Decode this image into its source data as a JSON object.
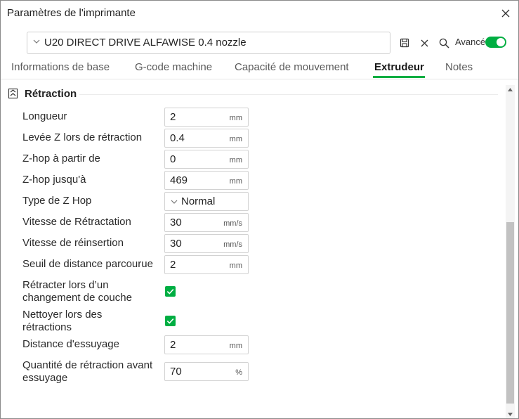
{
  "window": {
    "title": "Paramètres de l'imprimante"
  },
  "preset": {
    "name": "U20 DIRECT DRIVE ALFAWISE 0.4 nozzle",
    "advanced_label": "Avancé",
    "advanced_on": true
  },
  "tabs": [
    {
      "label": "Informations de base"
    },
    {
      "label": "G-code machine"
    },
    {
      "label": "Capacité de mouvement"
    },
    {
      "label": "Extrudeur",
      "active": true
    },
    {
      "label": "Notes"
    }
  ],
  "section": {
    "title": "Rétraction"
  },
  "settings": [
    {
      "label": "Longueur",
      "value": "2",
      "unit": "mm"
    },
    {
      "label": "Levée Z lors de rétraction",
      "value": "0.4",
      "unit": "mm"
    },
    {
      "label": "Z-hop à partir de",
      "value": "0",
      "unit": "mm"
    },
    {
      "label": "Z-hop jusqu'à",
      "value": "469",
      "unit": "mm"
    },
    {
      "label": "Type de Z Hop",
      "value": "Normal"
    },
    {
      "label": "Vitesse de Rétractation",
      "value": "30",
      "unit": "mm/s"
    },
    {
      "label": "Vitesse de réinsertion",
      "value": "30",
      "unit": "mm/s"
    },
    {
      "label": "Seuil de distance parcourue",
      "value": "2",
      "unit": "mm"
    },
    {
      "label_line1": "Rétracter lors d’un",
      "label_line2": "changement de couche",
      "checked": true
    },
    {
      "label_line1": "Nettoyer lors des",
      "label_line2": "rétractions",
      "checked": true
    },
    {
      "label": "Distance d'essuyage",
      "value": "2",
      "unit": "mm"
    },
    {
      "label_line1": "Quantité de rétraction avant",
      "label_line2": "essuyage",
      "value": "70",
      "unit": "%"
    }
  ],
  "colors": {
    "accent": "#00ae42"
  },
  "icons": [
    "close-icon",
    "chevron-down-icon",
    "save-icon",
    "delete-icon",
    "search-icon",
    "collapse-section-icon",
    "check-icon"
  ]
}
